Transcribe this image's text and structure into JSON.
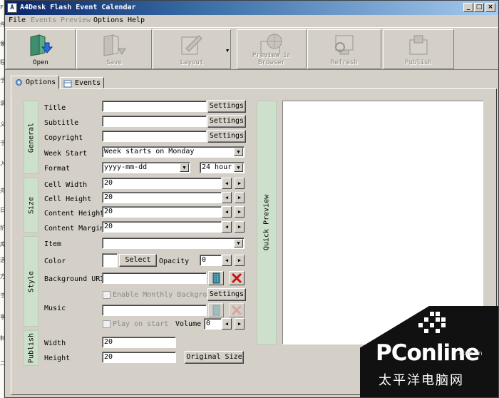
{
  "left_strip_chars": [
    "F",
    "件",
    "象",
    "程",
    "于",
    "录",
    "义",
    "于",
    "入",
    "舟",
    "日",
    "护",
    "库",
    "选",
    "方",
    "于",
    "享",
    "制",
    "二"
  ],
  "window": {
    "title": "A4Desk Flash Event Calendar",
    "app_icon": "A",
    "controls": {
      "minimize": "_",
      "maximize": "□",
      "close": "×"
    }
  },
  "menu": [
    {
      "label": "File",
      "enabled": true
    },
    {
      "label": "Events",
      "enabled": false
    },
    {
      "label": "Preview",
      "enabled": false
    },
    {
      "label": "Options",
      "enabled": true
    },
    {
      "label": "Help",
      "enabled": true
    }
  ],
  "toolbar": [
    {
      "label": "Open",
      "icon": "folder-open-icon",
      "enabled": true
    },
    {
      "label": "Save",
      "icon": "save-folder-icon",
      "enabled": false
    },
    {
      "label": "Layout",
      "icon": "layout-hand-icon",
      "enabled": false
    },
    {
      "label": "Preview in Browser",
      "icon": "globe-monitor-icon",
      "enabled": false
    },
    {
      "label": "Refresh",
      "icon": "refresh-monitor-icon",
      "enabled": false
    },
    {
      "label": "Publish",
      "icon": "publish-box-icon",
      "enabled": false
    }
  ],
  "tabs": [
    {
      "label": "Options",
      "icon": "options-tab-icon",
      "active": true
    },
    {
      "label": "Events",
      "icon": "events-tab-icon",
      "active": false
    }
  ],
  "groups": {
    "general": "General",
    "size": "Size",
    "style": "Style",
    "publish": "Publish"
  },
  "general": {
    "title_label": "Title",
    "title_value": "",
    "subtitle_label": "Subtitle",
    "subtitle_value": "",
    "copyright_label": "Copyright",
    "copyright_value": "",
    "settings_button": "Settings",
    "week_start_label": "Week Start",
    "week_start_value": "Week starts on Monday",
    "format_label": "Format",
    "format_value": "yyyy-mm-dd",
    "hour_format_value": "24 hour"
  },
  "size": {
    "cell_width_label": "Cell Width",
    "cell_width_value": "20",
    "cell_height_label": "Cell Height",
    "cell_height_value": "20",
    "content_height_label": "Content Height",
    "content_height_value": "20",
    "content_margin_label": "Content Margin",
    "content_margin_value": "20"
  },
  "style": {
    "item_label": "Item",
    "item_value": "",
    "color_label": "Color",
    "select_button": "Select",
    "opacity_label": "Opacity",
    "opacity_value": "0",
    "background_uri_label": "Background URI",
    "background_uri_value": "",
    "enable_monthly_label": "Enable Monthly Background",
    "enable_monthly_checked": false,
    "settings_button": "Settings",
    "music_label": "Music",
    "music_value": "",
    "play_on_start_label": "Play on start",
    "play_on_start_checked": false,
    "volume_label": "Volume",
    "volume_value": "0"
  },
  "publish": {
    "width_label": "Width",
    "width_value": "20",
    "height_label": "Height",
    "height_value": "20",
    "original_size_button": "Original Size"
  },
  "quick_preview_label": "Quick Preview",
  "spinner": {
    "left": "◀",
    "right": "▶"
  },
  "dropdown_glyph": "▼",
  "watermark": {
    "brand": "PConline",
    "domain": ".com.cn",
    "chinese": "太平洋电脑网"
  },
  "colors": {
    "titlebar_start": "#0a246a",
    "titlebar_end": "#a6caf0",
    "group_bar": "#cce0cc",
    "window_face": "#d4d0c8"
  }
}
